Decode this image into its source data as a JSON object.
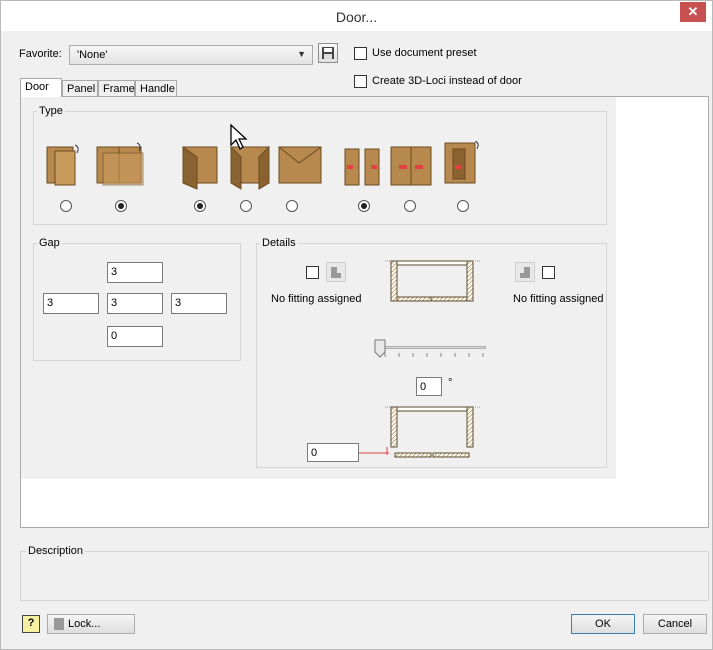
{
  "window": {
    "title": "Door...",
    "close_glyph": "✕"
  },
  "favorite": {
    "label": "Favorite:",
    "value": "'None'"
  },
  "options": {
    "use_document_preset": "Use document preset",
    "create_3d_loci": "Create 3D-Loci instead of door"
  },
  "tabs": [
    {
      "label": "Door",
      "active": true
    },
    {
      "label": "Panel",
      "active": false
    },
    {
      "label": "Frame",
      "active": false
    },
    {
      "label": "Handle",
      "active": false
    }
  ],
  "type_group": {
    "title": "Type",
    "selected": [
      false,
      true,
      true,
      false,
      false,
      true,
      false,
      false
    ]
  },
  "gap": {
    "title": "Gap",
    "top": "3",
    "left": "3",
    "center": "3",
    "right": "3",
    "bottom": "0"
  },
  "details": {
    "title": "Details",
    "left_fitting": "No fitting assigned",
    "right_fitting": "No fitting assigned",
    "angle": "0",
    "angle_unit": "°",
    "offset": "0"
  },
  "description": {
    "label": "Description"
  },
  "footer": {
    "help_glyph": "?",
    "lock": "Lock...",
    "ok": "OK",
    "cancel": "Cancel"
  },
  "colors": {
    "close": "#c75050",
    "door_wood": "#b8894e",
    "arrow_red": "#e04040"
  }
}
